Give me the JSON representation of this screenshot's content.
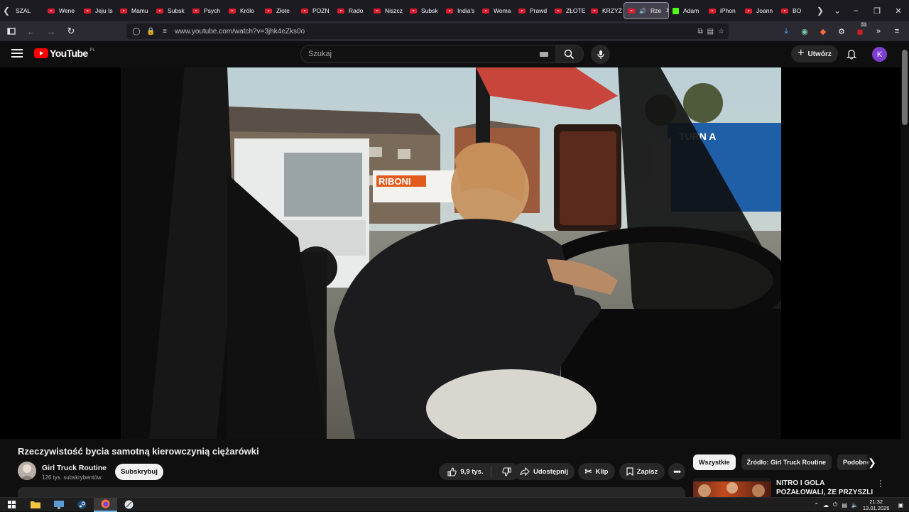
{
  "browser": {
    "tabs": [
      {
        "label": "SZAL",
        "icon": "none"
      },
      {
        "label": "Wene",
        "icon": "youtube"
      },
      {
        "label": "Jeju Is",
        "icon": "youtube"
      },
      {
        "label": "Mamu",
        "icon": "youtube"
      },
      {
        "label": "Subsk",
        "icon": "youtube"
      },
      {
        "label": "Psych",
        "icon": "youtube"
      },
      {
        "label": "Królo",
        "icon": "youtube"
      },
      {
        "label": "Złote",
        "icon": "youtube"
      },
      {
        "label": "POZN",
        "icon": "youtube"
      },
      {
        "label": "Rado",
        "icon": "youtube"
      },
      {
        "label": "Niszcz",
        "icon": "youtube"
      },
      {
        "label": "Subsk",
        "icon": "youtube"
      },
      {
        "label": "India's",
        "icon": "youtube"
      },
      {
        "label": "Woma",
        "icon": "youtube"
      },
      {
        "label": "Prawd",
        "icon": "youtube"
      },
      {
        "label": "ZŁOTE",
        "icon": "youtube"
      },
      {
        "label": "KRZYŻ",
        "icon": "youtube"
      },
      {
        "label": "Rze",
        "icon": "youtube",
        "active": true
      },
      {
        "label": "Adam",
        "icon": "kick"
      },
      {
        "label": "iPhon",
        "icon": "youtube"
      },
      {
        "label": "Joann",
        "icon": "youtube"
      },
      {
        "label": "BO",
        "icon": "youtube"
      }
    ],
    "url": "www.youtube.com/watch?v=3jhk4eZks0o",
    "extension_badge": "51"
  },
  "youtube": {
    "logo_text": "YouTube",
    "logo_country": "PL",
    "search_placeholder": "Szukaj",
    "create_label": "Utwórz",
    "avatar_letter": "K"
  },
  "video": {
    "title": "Rzeczywistość bycia samotną kierowczynią ciężarówki",
    "channel_name": "Girl Truck Routine",
    "channel_subs": "126 tys. subskrybentów",
    "subscribe_label": "Subskrybuj",
    "likes": "9,9 tys.",
    "share_label": "Udostępnij",
    "clip_label": "Klip",
    "save_label": "Zapisz",
    "scene_text": {
      "truck_logo": "RIBONI",
      "trailer_text": "TURN A"
    }
  },
  "sidebar": {
    "chips": [
      "Wszystkie",
      "Źródło: Girl Truck Routine",
      "Podobne"
    ],
    "recommendation_title": "NITRO I GOLA POŻAŁOWALI, ŻE PRZYSZLI xD"
  },
  "taskbar": {
    "time": "21:32",
    "date": "13.01.2026"
  },
  "colors": {
    "youtube_red": "#ff0000",
    "background": "#0f0f0f",
    "avatar": "#7e3fd0"
  }
}
